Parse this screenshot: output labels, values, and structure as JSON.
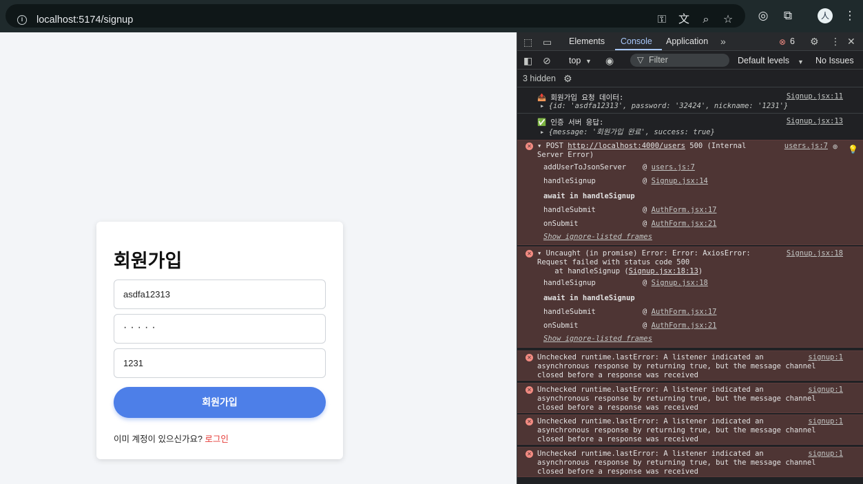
{
  "browser": {
    "url": "localhost:5174/signup",
    "icons": [
      "info-icon",
      "key-icon",
      "translate-icon",
      "zoom-icon",
      "star-icon",
      "extension-target-icon",
      "puzzle-icon",
      "avatar",
      "kebab-menu-icon"
    ]
  },
  "signup": {
    "title": "회원가입",
    "id_value": "asdfa12313",
    "password_mask": "·····",
    "nickname_value": "1231",
    "submit_label": "회원가입",
    "footer_text": "이미 계정이 있으신가요? ",
    "login_link": "로그인",
    "accent_color": "#4d7fe8",
    "link_color": "#e53935"
  },
  "devtools": {
    "tabs": [
      "Elements",
      "Console",
      "Application"
    ],
    "active_tab": "Console",
    "error_count": "6",
    "context": "top",
    "filter_placeholder": "Filter",
    "levels": "Default levels",
    "issues": "No Issues",
    "hidden": "3 hidden",
    "messages": {
      "m1_label": "📤 회원가입 요청 데이터:",
      "m1_src": "Signup.jsx:11",
      "m1_obj": "▸ {id: 'asdfa12313', password: '32424', nickname: '1231'}",
      "m2_label": "✅ 인증 서버 응답:",
      "m2_src": "Signup.jsx:13",
      "m2_obj": "▸ {message: '회원가입 완료', success: true}",
      "e1_line1_pre": "▾ POST ",
      "e1_url": "http://localhost:4000/users",
      "e1_line1_post": " 500 (Internal",
      "e1_line2": "Server Error)",
      "e1_src": "users.js:7",
      "e1_frames": [
        {
          "fn": "addUserToJsonServer",
          "at": "users.js:7"
        },
        {
          "fn": "handleSignup",
          "at": "Signup.jsx:14"
        },
        {
          "fn": "await in handleSignup",
          "at": ""
        },
        {
          "fn": "handleSubmit",
          "at": "AuthForm.jsx:17"
        },
        {
          "fn": "onSubmit",
          "at": "AuthForm.jsx:21"
        }
      ],
      "show_ignore": "Show ignore-listed frames",
      "e2_line1": "▾ Uncaught (in promise) Error: Error: AxiosError:",
      "e2_line2": "Request failed with status code 500",
      "e2_line3_pre": "    at handleSignup (",
      "e2_line3_link": "Signup.jsx:18:13",
      "e2_line3_post": ")",
      "e2_src": "Signup.jsx:18",
      "e2_frames": [
        {
          "fn": "handleSignup",
          "at": "Signup.jsx:18"
        },
        {
          "fn": "await in handleSignup",
          "at": ""
        },
        {
          "fn": "handleSubmit",
          "at": "AuthForm.jsx:17"
        },
        {
          "fn": "onSubmit",
          "at": "AuthForm.jsx:21"
        }
      ],
      "runtime_line1": "Unchecked runtime.lastError: A listener indicated an",
      "runtime_line2": "asynchronous response by returning true, but the message channel",
      "runtime_line3": "closed before a response was received",
      "runtime_src": "signup:1"
    }
  }
}
